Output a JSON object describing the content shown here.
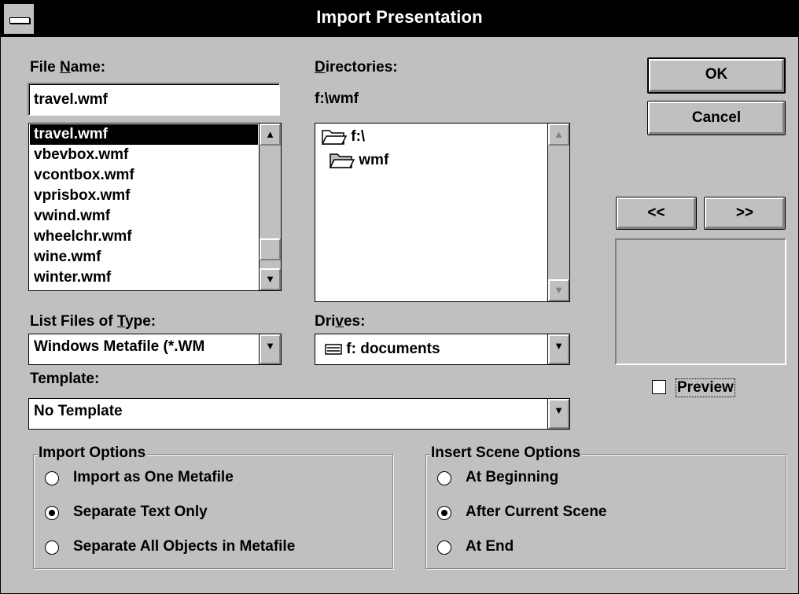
{
  "window": {
    "title": "Import Presentation"
  },
  "file_name": {
    "label_prefix": "File ",
    "label_accel": "N",
    "label_suffix": "ame:",
    "value": "travel.wmf",
    "files": [
      "travel.wmf",
      "vbevbox.wmf",
      "vcontbox.wmf",
      "vprisbox.wmf",
      "vwind.wmf",
      "wheelchr.wmf",
      "wine.wmf",
      "winter.wmf"
    ],
    "selected_index": 0
  },
  "directories": {
    "label_accel": "D",
    "label_suffix": "irectories:",
    "current_path": "f:\\wmf",
    "items": [
      {
        "name": "f:\\",
        "icon": "open-folder-icon"
      },
      {
        "name": "wmf",
        "icon": "open-folder-icon"
      }
    ]
  },
  "buttons": {
    "ok": "OK",
    "cancel": "Cancel",
    "prev": "<<",
    "next": ">>"
  },
  "list_type": {
    "label_prefix": "List Files of ",
    "label_accel": "T",
    "label_suffix": "ype:",
    "value": "Windows Metafile (*.WM"
  },
  "drives": {
    "label_prefix": "Dri",
    "label_accel": "v",
    "label_suffix": "es:",
    "value": "f: documents",
    "icon": "drive-icon"
  },
  "template": {
    "label": "Template:",
    "value": "No Template"
  },
  "preview": {
    "label": "Preview",
    "checked": false
  },
  "import_options": {
    "title": "Import Options",
    "options": [
      {
        "label": "Import as One Metafile",
        "selected": false
      },
      {
        "label": "Separate Text Only",
        "selected": true
      },
      {
        "label": "Separate All Objects in Metafile",
        "selected": false
      }
    ]
  },
  "insert_scene_options": {
    "title": "Insert Scene Options",
    "options": [
      {
        "label": "At Beginning",
        "selected": false
      },
      {
        "label": "After Current Scene",
        "selected": true
      },
      {
        "label": "At End",
        "selected": false
      }
    ]
  }
}
